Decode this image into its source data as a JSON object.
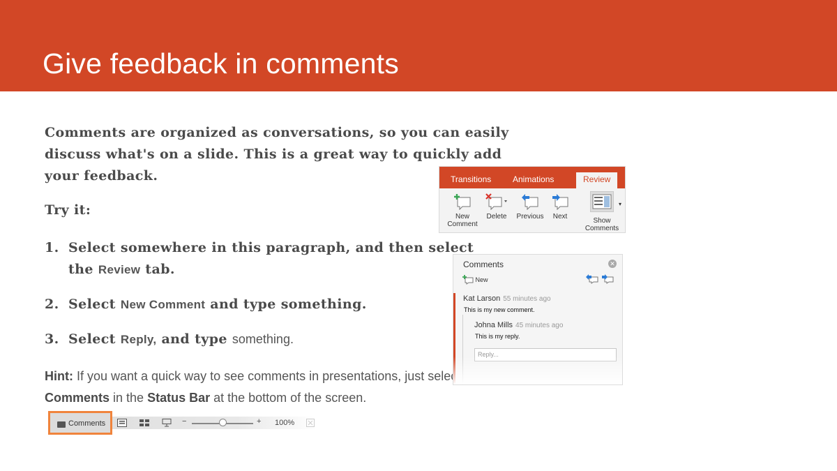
{
  "slide": {
    "title": "Give feedback in comments",
    "intro": "Comments are organized as conversations, so you can easily discuss what's on a slide. This is a great way to quickly add your feedback.",
    "try_label": "Try it:",
    "steps": [
      {
        "num": "1.",
        "a": "Select somewhere in this paragraph, and then select the ",
        "ui": "Review",
        "b": " tab.",
        "c": ""
      },
      {
        "num": "2.",
        "a": "Select ",
        "ui": "New Comment",
        "b": " and type something.",
        "c": ""
      },
      {
        "num": "3.",
        "a": "Select ",
        "ui": "Reply,",
        "b": " and type ",
        "c": "something."
      }
    ],
    "hint": {
      "label": "Hint:",
      "text1": " If you want a quick way to see comments in presentations, just select ",
      "comments": "Comments",
      "text2": " in the ",
      "status_bar": "Status Bar",
      "text3": " at the bottom of the screen."
    }
  },
  "ribbon": {
    "tabs": [
      "Transitions",
      "Animations",
      "Review"
    ],
    "buttons": {
      "new_comment_1": "New",
      "new_comment_2": "Comment",
      "delete": "Delete",
      "previous": "Previous",
      "next": "Next",
      "show_1": "Show",
      "show_2": "Comments"
    }
  },
  "comments_pane": {
    "title": "Comments",
    "new_label": "New",
    "comment": {
      "author": "Kat Larson",
      "time": "55 minutes ago",
      "body": "This is my new comment."
    },
    "reply": {
      "author": "Johna Mills",
      "time": "45 minutes ago",
      "body": "This is my reply."
    },
    "reply_placeholder": "Reply..."
  },
  "status_bar": {
    "comments_label": "Comments",
    "zoom": "100%",
    "minus": "−",
    "plus": "+"
  },
  "colors": {
    "accent": "#d24726",
    "highlight": "#f0843c"
  }
}
